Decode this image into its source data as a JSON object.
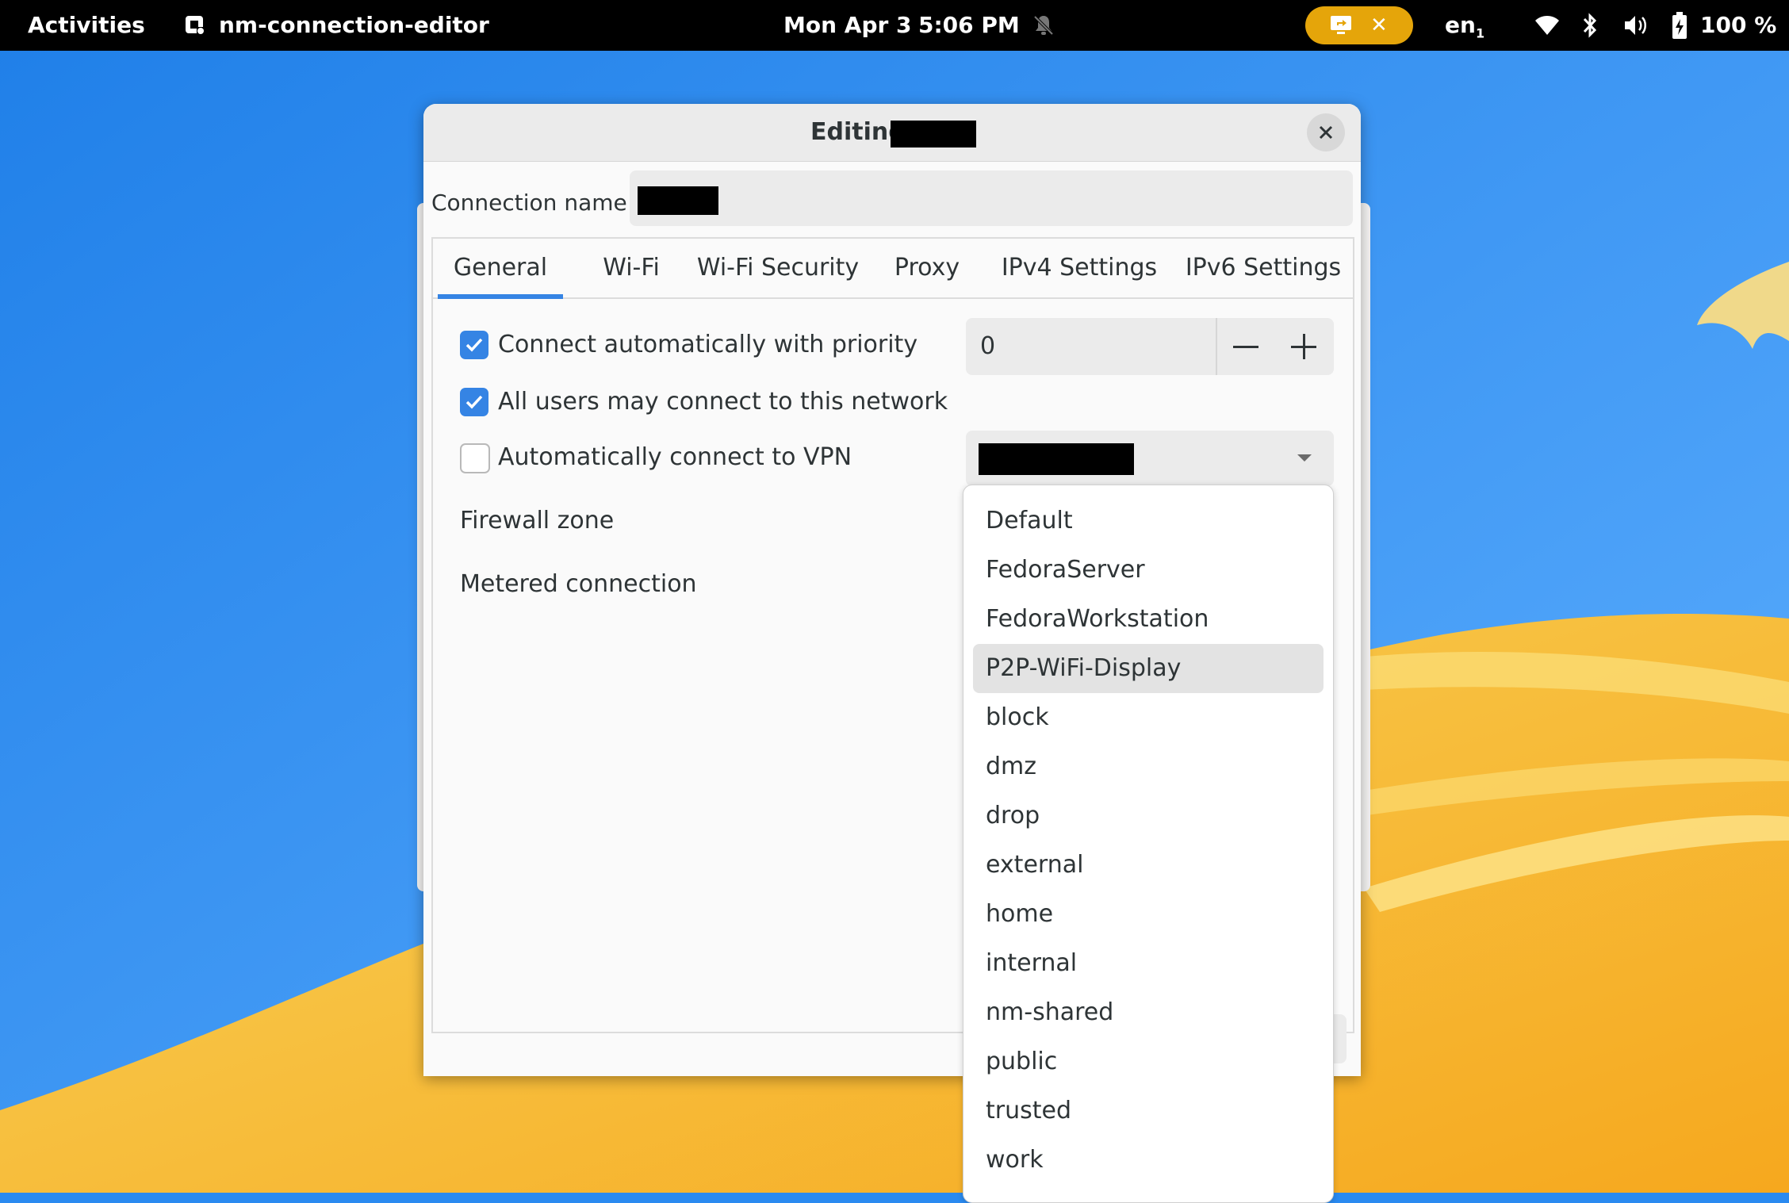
{
  "topbar": {
    "activities": "Activities",
    "app_name": "nm-connection-editor",
    "date": "Mon Apr 3",
    "time": "5:06 PM",
    "pill_close": "✕",
    "lang": "en",
    "lang_sub": "1",
    "battery": "100 %"
  },
  "dialog": {
    "title": "Editing",
    "connection_name_label": "Connection name",
    "tabs": [
      "General",
      "Wi-Fi",
      "Wi-Fi Security",
      "Proxy",
      "IPv4 Settings",
      "IPv6 Settings"
    ],
    "active_tab": "General",
    "connect_auto": {
      "label": "Connect automatically with priority",
      "checked": true
    },
    "priority": "0",
    "all_users": {
      "label": "All users may connect to this network",
      "checked": true
    },
    "auto_vpn": {
      "label": "Automatically connect to VPN",
      "checked": false
    },
    "firewall_zone_label": "Firewall zone",
    "metered_label": "Metered connection"
  },
  "dropdown": {
    "items": [
      "Default",
      "FedoraServer",
      "FedoraWorkstation",
      "P2P-WiFi-Display",
      "block",
      "dmz",
      "drop",
      "external",
      "home",
      "internal",
      "nm-shared",
      "public",
      "trusted",
      "work"
    ],
    "highlighted": "P2P-WiFi-Display"
  },
  "colors": {
    "accent": "#3584e4",
    "topbar_bg": "#000000",
    "pill": "#e5a50a",
    "wallpaper_blue": "#2a8af0",
    "wallpaper_yellow": "#f7c23a"
  }
}
